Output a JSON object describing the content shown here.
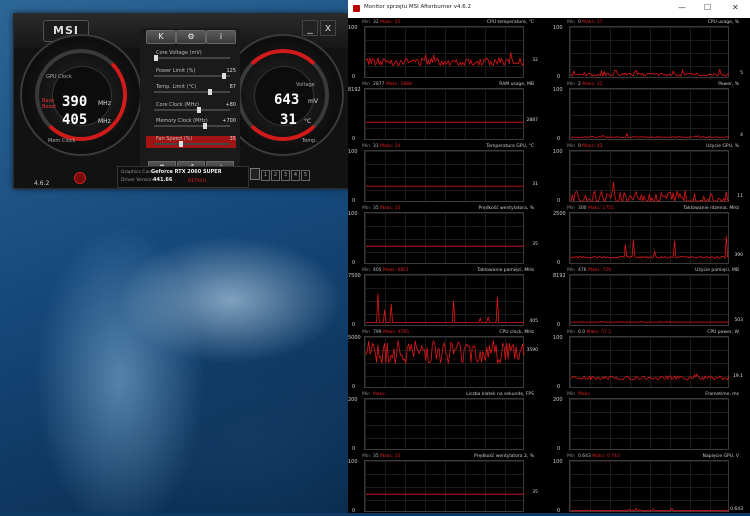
{
  "afterburner": {
    "logo": "MSI",
    "version": "4.6.2",
    "window_buttons": [
      "_",
      "x"
    ],
    "gpu_gauge": {
      "label_top": "GPU Clock",
      "label_mem": "Mem Clock",
      "legend_base": "Base",
      "legend_boost": "Boost",
      "clock_value": "390",
      "clock_unit": "MHz",
      "mem_value": "405",
      "mem_unit": "MHz"
    },
    "voltage_gauge": {
      "label_top": "Voltage",
      "label_temp": "Temp.",
      "voltage_value": "643",
      "voltage_unit": "mV",
      "temp_value": "31",
      "temp_unit": "°C"
    },
    "tabs": [
      "K",
      "⚙",
      "i"
    ],
    "sliders": [
      {
        "label": "Core Voltage (mV)",
        "value": "",
        "level": 0.0
      },
      {
        "label": "Power Limit (%)",
        "value": "125",
        "level": 0.95
      },
      {
        "label": "Temp. Limit (°C)",
        "value": "87",
        "level": 0.75
      },
      {
        "label": "Core Clock (MHz)",
        "value": "+80",
        "level": 0.6
      },
      {
        "label": "Memory Clock (MHz)",
        "value": "+700",
        "level": 0.68
      },
      {
        "label": "Fan Speed (%)",
        "value": "35",
        "level": 0.35
      }
    ],
    "actions": [
      "⚙",
      "↺",
      "✓"
    ],
    "info": {
      "gpu_key": "Graphics Card:",
      "gpu_value": "Geforce RTX 2060 SUPER",
      "driver_key": "Driver Version:",
      "driver_value": "441.66",
      "detach": "DETACH"
    },
    "profiles": [
      "1",
      "2",
      "3",
      "4",
      "5"
    ],
    "colors": {
      "accent": "#d11b1b"
    }
  },
  "monitor": {
    "title": "Monitor sprzętu MSI Afterburner v4.6.2",
    "window_controls": [
      "—",
      "☐",
      "✕"
    ],
    "labels": {
      "min": "Min",
      "max": "Maks"
    },
    "panels": [
      {
        "name": "CPU temperature, °C",
        "min": "32",
        "max": "55",
        "ymax": "100",
        "ymin": "0",
        "cur": "32",
        "base": 0.32,
        "noise": 0.08,
        "spikes": 0.2
      },
      {
        "name": "CPU usage, %",
        "min": "0",
        "max": "17",
        "ymax": "100",
        "ymin": "0",
        "cur": "5",
        "base": 0.05,
        "noise": 0.03,
        "spikes": 0.12
      },
      {
        "name": "RAM usage, MB",
        "min": "2877",
        "max": "2888",
        "ymax": "8192",
        "ymin": "0",
        "cur": "2887",
        "base": 0.35,
        "noise": 0.0,
        "spikes": 0.0
      },
      {
        "name": "Power, %",
        "min": "2",
        "max": "21",
        "ymax": "100",
        "ymin": "0",
        "cur": "4",
        "base": 0.04,
        "noise": 0.01,
        "spikes": 0.1
      },
      {
        "name": "Temperatura GPU, °C",
        "min": "31",
        "max": "34",
        "ymax": "100",
        "ymin": "0",
        "cur": "31",
        "base": 0.31,
        "noise": 0.0,
        "spikes": 0.0
      },
      {
        "name": "Użycie GPU, %",
        "min": "0",
        "max": "43",
        "ymax": "100",
        "ymin": "0",
        "cur": "11",
        "base": 0.06,
        "noise": 0.15,
        "spikes": 0.35
      },
      {
        "name": "Prędkość wentylatora, %",
        "min": "35",
        "max": "35",
        "ymax": "100",
        "ymin": "0",
        "cur": "35",
        "base": 0.35,
        "noise": 0.0,
        "spikes": 0.0
      },
      {
        "name": "Taktowanie rdzenia, MHz",
        "min": "300",
        "max": "1755",
        "ymax": "2500",
        "ymin": "0",
        "cur": "390",
        "base": 0.12,
        "noise": 0.02,
        "spikes": 0.55
      },
      {
        "name": "Taktowanie pamięci, MHz",
        "min": "405",
        "max": "6851",
        "ymax": "7500",
        "ymin": "0",
        "cur": "405",
        "base": 0.05,
        "noise": 0.0,
        "spikes": 0.85
      },
      {
        "name": "Użycie pamięci, MB",
        "min": "476",
        "max": "729",
        "ymax": "8192",
        "ymin": "0",
        "cur": "503",
        "base": 0.06,
        "noise": 0.0,
        "spikes": 0.02
      },
      {
        "name": "CPU clock, MHz",
        "min": "799",
        "max": "4785",
        "ymax": "5000",
        "ymin": "0",
        "cur": "3590",
        "base": 0.72,
        "noise": 0.25,
        "spikes": 0.2
      },
      {
        "name": "CPU power, W",
        "min": "6.0",
        "max": "57.2",
        "ymax": "100",
        "ymin": "0",
        "cur": "19.1",
        "base": 0.19,
        "noise": 0.04,
        "spikes": 0.15
      },
      {
        "name": "Liczba klatek na sekundę, FPS",
        "min": "",
        "max": "",
        "ymax": "200",
        "ymin": "0",
        "cur": "",
        "base": null,
        "noise": 0,
        "spikes": 0
      },
      {
        "name": "Frametime, ms",
        "min": "",
        "max": "",
        "ymax": "200",
        "ymin": "0",
        "cur": "",
        "base": null,
        "noise": 0,
        "spikes": 0
      },
      {
        "name": "Prędkość wentylatora 2, %",
        "min": "35",
        "max": "35",
        "ymax": "100",
        "ymin": "0",
        "cur": "35",
        "base": 0.35,
        "noise": 0.0,
        "spikes": 0.0
      },
      {
        "name": "Napięcie GPU, V",
        "min": "0.643",
        "max": "0.743",
        "ymax": "100",
        "ymin": "0",
        "cur": "0.643",
        "base": 0.006,
        "noise": 0.0,
        "spikes": 0.06
      }
    ],
    "colors": {
      "line": "#e01818",
      "grid": "#1b1b1b"
    }
  }
}
